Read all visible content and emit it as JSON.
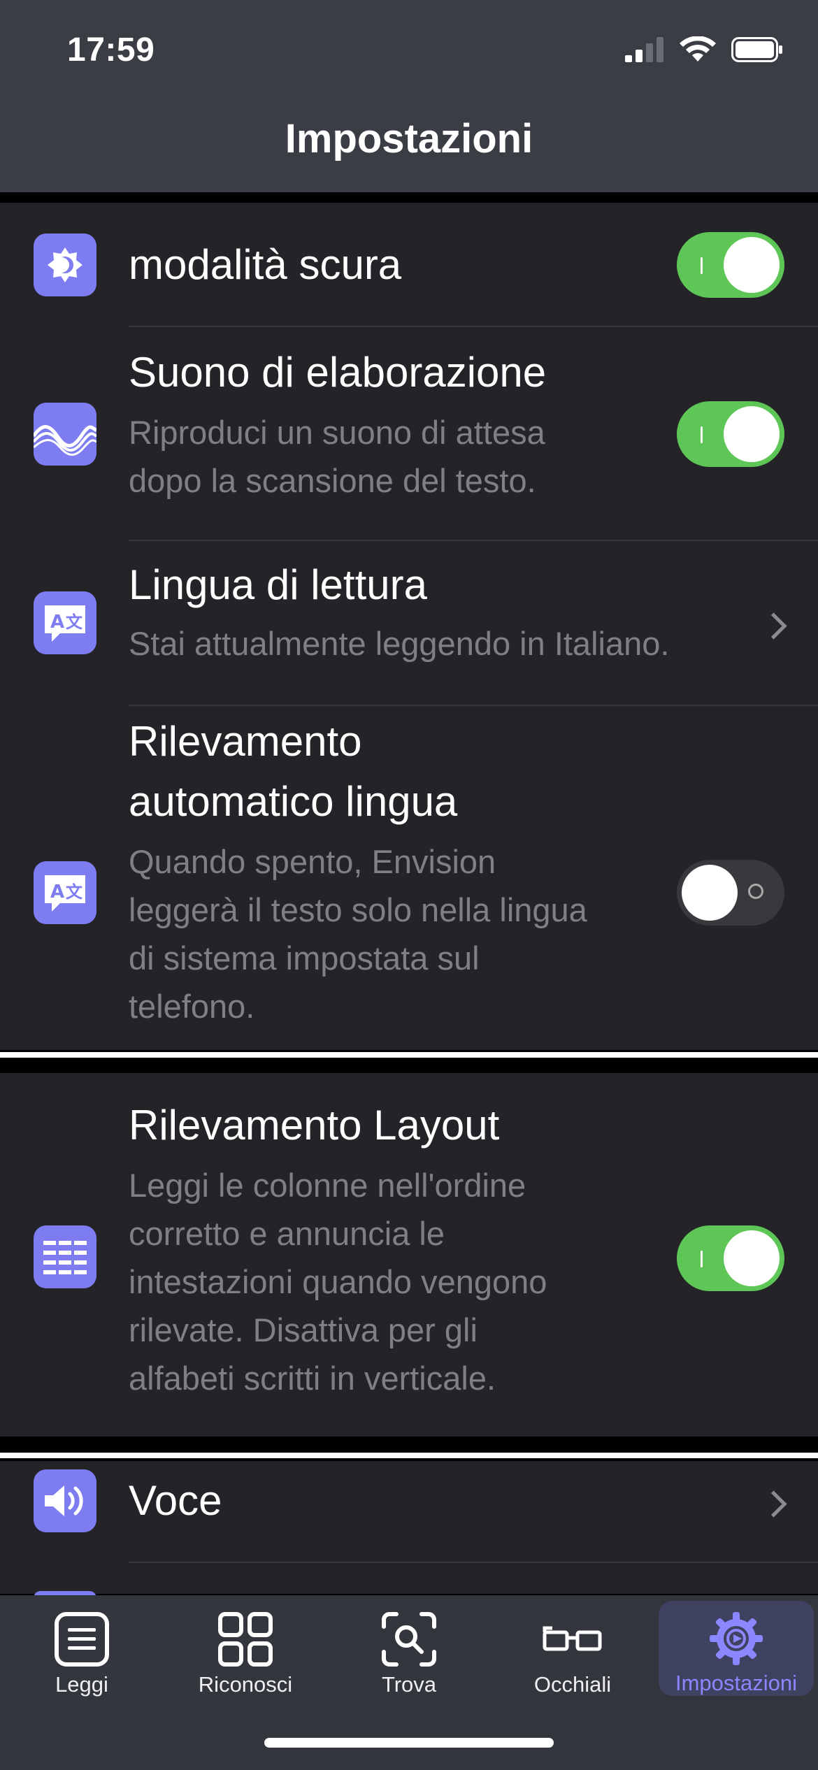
{
  "status_bar": {
    "time": "17:59"
  },
  "nav": {
    "title": "Impostazioni"
  },
  "settings": {
    "dark_mode": {
      "title": "modalità scura",
      "enabled": true,
      "icon": "dark-mode-icon"
    },
    "processing_sound": {
      "title": "Suono di elaborazione",
      "subtitle": [
        "Riproduci un suono di attesa",
        "dopo la scansione del testo."
      ],
      "enabled": true,
      "icon": "sound-wave-icon"
    },
    "reading_language": {
      "title": "Lingua di lettura",
      "subtitle": "Stai attualmente leggendo in Italiano.",
      "icon": "translate-icon"
    },
    "auto_language": {
      "title": [
        "Rilevamento",
        "automatico lingua"
      ],
      "subtitle": [
        "Quando spento, Envision",
        "leggerà il testo solo nella lingua",
        "di sistema impostata sul",
        "telefono."
      ],
      "enabled": false,
      "icon": "translate-icon"
    },
    "layout_detection": {
      "title": "Rilevamento Layout",
      "subtitle": [
        "Leggi le colonne nell'ordine",
        "corretto e annuncia le",
        "intestazioni quando vengono",
        "rilevate. Disattiva per gli",
        "alfabeti scritti in verticale."
      ],
      "enabled": true,
      "icon": "layout-columns-icon"
    },
    "voice": {
      "title": "Voce",
      "icon": "speaker-icon"
    }
  },
  "tabs": [
    {
      "label": "Leggi",
      "icon": "read-document-icon",
      "active": false
    },
    {
      "label": "Riconosci",
      "icon": "grid-icon",
      "active": false
    },
    {
      "label": "Trova",
      "icon": "scan-search-icon",
      "active": false
    },
    {
      "label": "Occhiali",
      "icon": "glasses-icon",
      "active": false
    },
    {
      "label": "Impostazioni",
      "icon": "settings-gear-icon",
      "active": true
    }
  ],
  "colors": {
    "accent": "#7d7cf0",
    "toggle_on": "#5ec656",
    "active_tab_label": "#8a87ff"
  }
}
